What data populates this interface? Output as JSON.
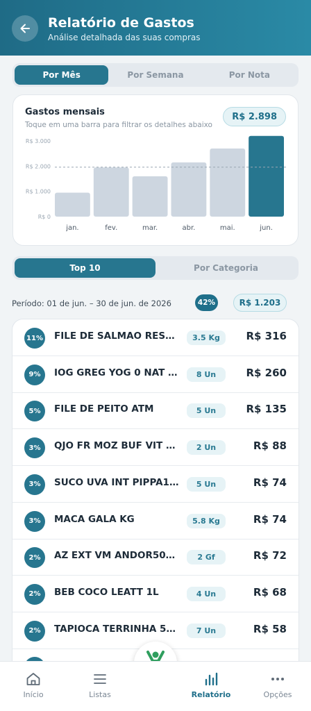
{
  "header": {
    "title": "Relatório de Gastos",
    "subtitle": "Análise detalhada das suas compras"
  },
  "period_tabs": [
    {
      "label": "Por Mês",
      "active": true
    },
    {
      "label": "Por Semana",
      "active": false
    },
    {
      "label": "Por Nota",
      "active": false
    }
  ],
  "chart_card": {
    "title": "Gastos mensais",
    "subtitle": "Toque em uma barra para filtrar os detalhes abaixo",
    "total": "R$ 2.898"
  },
  "chart_data": {
    "type": "bar",
    "categories": [
      "jan.",
      "fev.",
      "mar.",
      "abr.",
      "mai.",
      "jun."
    ],
    "values": [
      950,
      1950,
      1600,
      2150,
      2700,
      3200
    ],
    "y_ticks": [
      "R$ 0",
      "R$ 1.000",
      "R$ 2.000",
      "R$ 3.000"
    ],
    "y_tick_values": [
      0,
      1000,
      2000,
      3000
    ],
    "ylim": [
      0,
      3000
    ],
    "average_line": 1960,
    "highlighted_index": 5,
    "colors": {
      "bar": "#cdd6e0",
      "highlight": "#27768f",
      "average": "#9aa6b2"
    }
  },
  "view_tabs": [
    {
      "label": "Top 10",
      "active": true
    },
    {
      "label": "Por Categoria",
      "active": false
    }
  ],
  "period": {
    "label": "Período: 01 de jun. – 30 de jun. de 2026",
    "percent": "42%",
    "total": "R$ 1.203"
  },
  "items": [
    {
      "pct": "11%",
      "name": "FILE DE SALMAO RESF ...",
      "qty": "3.5 Kg",
      "price": "R$ 316"
    },
    {
      "pct": "9%",
      "name": "IOG GREG YOG 0 NAT 5...",
      "qty": "8 Un",
      "price": "R$ 260"
    },
    {
      "pct": "5%",
      "name": "FILE DE PEITO ATM",
      "qty": "5 Un",
      "price": "R$ 135"
    },
    {
      "pct": "3%",
      "name": "QJO FR MOZ BUF VIT M...",
      "qty": "2 Un",
      "price": "R$ 88"
    },
    {
      "pct": "3%",
      "name": "SUCO UVA INT PIPPA1 35",
      "qty": "5 Un",
      "price": "R$ 74"
    },
    {
      "pct": "3%",
      "name": "MACA GALA KG",
      "qty": "5.8 Kg",
      "price": "R$ 74"
    },
    {
      "pct": "2%",
      "name": "AZ EXT VM ANDOR500...",
      "qty": "2 Gf",
      "price": "R$ 72"
    },
    {
      "pct": "2%",
      "name": "BEB COCO LEATT 1L",
      "qty": "4 Un",
      "price": "R$ 68"
    },
    {
      "pct": "2%",
      "name": "TAPIOCA TERRINHA 50...",
      "qty": "7 Un",
      "price": "R$ 58"
    }
  ],
  "bottom_nav": [
    {
      "label": "Início",
      "icon": "home-icon",
      "active": false
    },
    {
      "label": "Listas",
      "icon": "list-icon",
      "active": false
    },
    {
      "label": "Relatório",
      "icon": "bar-chart-icon",
      "active": true
    },
    {
      "label": "Opções",
      "icon": "more-icon",
      "active": false
    }
  ],
  "colors": {
    "primary": "#27768f",
    "header_start": "#1f6b86",
    "header_end": "#2a8aa6"
  }
}
